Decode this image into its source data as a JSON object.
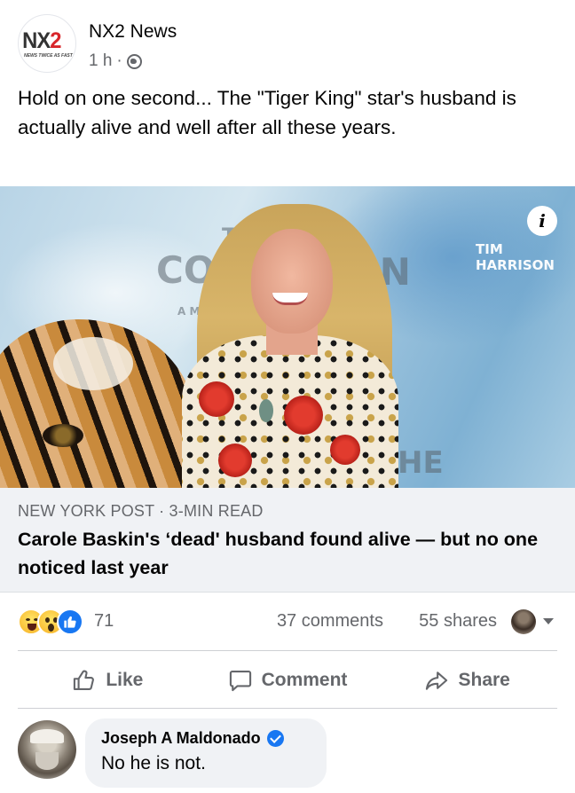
{
  "post": {
    "page_name": "NX2 News",
    "logo_text_main": "NX",
    "logo_text_num": "2",
    "logo_tagline": "NEWS TWICE AS FAST",
    "time": "1 h",
    "time_separator": "·",
    "audience_icon": "globe-icon",
    "text": "Hold on one second... The \"Tiger King\" star's husband is actually alive and well after all these years."
  },
  "image": {
    "ghost_text_1": "THE",
    "ghost_text_2": "CONS",
    "ghost_text_3": "ON",
    "ghost_text_4": "A MICH",
    "ghost_text_5": "HE",
    "ghost_text_6": "TIM HARRISON",
    "info_label": "i"
  },
  "link": {
    "source": "NEW YORK POST · 3-MIN READ",
    "title": "Carole Baskin's ‘dead' husband found alive — but no one noticed last year"
  },
  "engagement": {
    "reaction_icons": [
      "haha-icon",
      "wow-icon",
      "like-icon"
    ],
    "reaction_count": "71",
    "comments": "37 comments",
    "shares": "55 shares"
  },
  "actions": {
    "like": "Like",
    "comment": "Comment",
    "share": "Share"
  },
  "comment": {
    "author": "Joseph A Maldonado",
    "text": "No he is not."
  },
  "colors": {
    "accent": "#1877f2",
    "secondary_text": "#65676b",
    "logo_red": "#d8262b"
  }
}
